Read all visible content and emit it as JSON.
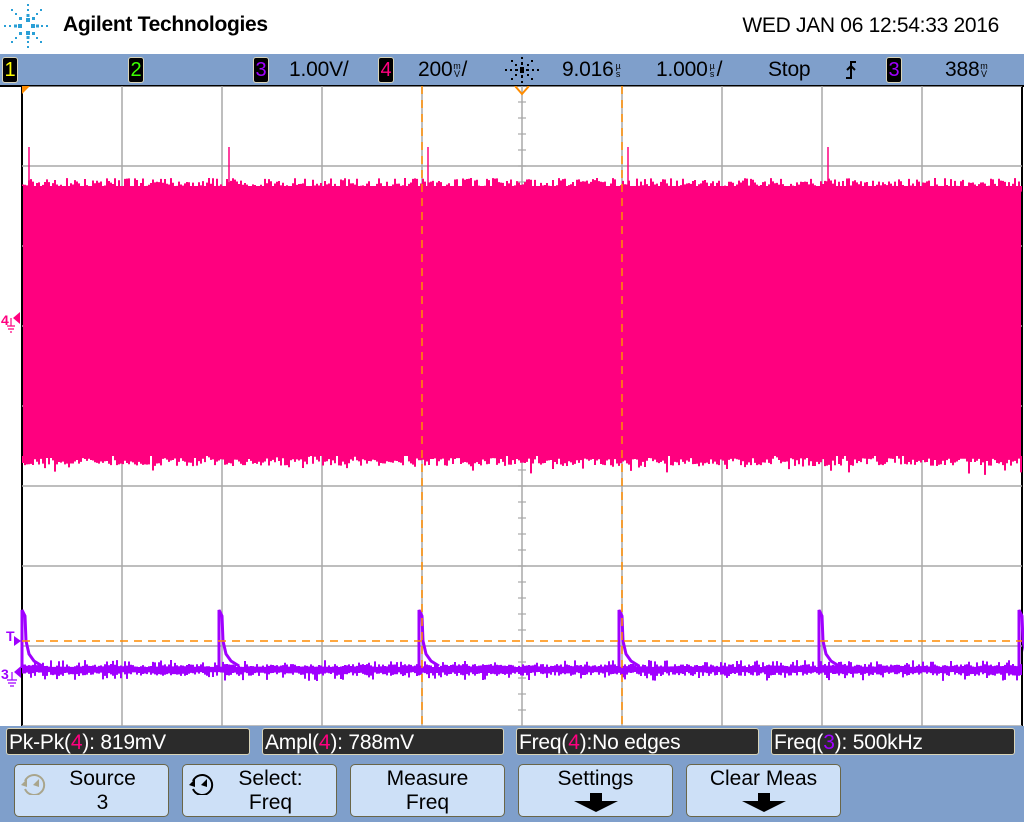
{
  "header": {
    "brand": "Agilent Technologies",
    "datetime": "WED JAN 06 12:54:33 2016"
  },
  "statusbar": {
    "channels": [
      {
        "id": "1",
        "color": "#ffff00",
        "scale": ""
      },
      {
        "id": "2",
        "color": "#3cff00",
        "scale": ""
      },
      {
        "id": "3",
        "color": "#a000ff",
        "scale": "1.00V/"
      },
      {
        "id": "4",
        "color": "#ff007f",
        "scale_value": "200",
        "scale_unit_top": "m",
        "scale_unit_bottom": "V",
        "scale_suffix": "/"
      }
    ],
    "acquire_icon": "acquisition-sparkle-icon",
    "delay_value": "9.016",
    "delay_unit_top": "µ",
    "delay_unit_bottom": "s",
    "timebase_value": "1.000",
    "timebase_unit_top": "µ",
    "timebase_unit_bottom": "s",
    "timebase_suffix": "/",
    "run_state": "Stop",
    "trigger_slope_icon": "rising-edge-icon",
    "trigger_source": "3",
    "trigger_level_value": "388",
    "trigger_level_unit_top": "m",
    "trigger_level_unit_bottom": "V"
  },
  "display": {
    "colors": {
      "ch3": "#a000ff",
      "ch4": "#ff007f",
      "grid": "#a8a8a8",
      "cursor": "#ff8c00"
    },
    "markers": {
      "ch4_label": "4",
      "ch3_label": "3",
      "trigger_label": "T"
    },
    "grid_divisions": {
      "horizontal": 10,
      "vertical": 8
    }
  },
  "measurements": [
    {
      "name": "Pk-Pk(",
      "channel": "4",
      "channel_color": "#ff007f",
      "suffix": "): 819mV"
    },
    {
      "name": "Ampl(",
      "channel": "4",
      "channel_color": "#ff007f",
      "suffix": "): 788mV"
    },
    {
      "name": "Freq(",
      "channel": "4",
      "channel_color": "#ff007f",
      "suffix": "):No edges"
    },
    {
      "name": "Freq(",
      "channel": "3",
      "channel_color": "#a000ff",
      "suffix": "): 500kHz"
    }
  ],
  "softkeys": [
    {
      "line1": "Source",
      "line2": "3",
      "icon": "entry-knob-icon-disabled"
    },
    {
      "line1": "Select:",
      "line2": "Freq",
      "icon": "entry-knob-icon"
    },
    {
      "line1": "Measure",
      "line2": "Freq",
      "icon": ""
    },
    {
      "line1": "Settings",
      "line2": "",
      "icon": "arrow-down-icon"
    },
    {
      "line1": "Clear Meas",
      "line2": "",
      "icon": "arrow-down-icon"
    }
  ]
}
